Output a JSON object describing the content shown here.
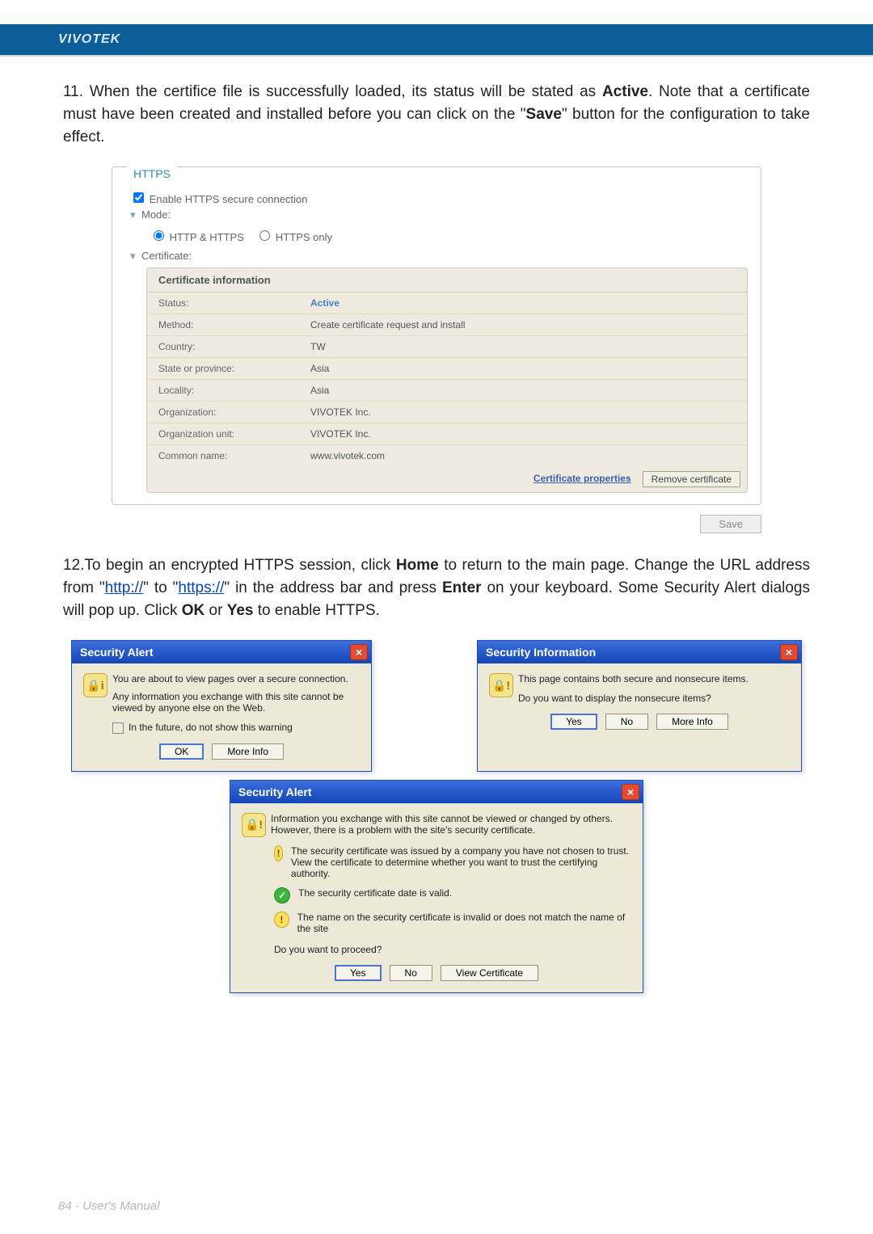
{
  "brand": "VIVOTEK",
  "step11": "11. When the certifice file is successfully loaded, its status will be stated as ",
  "step11_active": "Active",
  "step11_b": ". Note that a certificate must have been created and installed before you can click on the \"",
  "step11_save": "Save",
  "step11_c": "\" button for the configuration to take effect.",
  "https": {
    "legend": "HTTPS",
    "enable_label": "Enable HTTPS secure connection",
    "mode_label": "Mode:",
    "mode_a": "HTTP & HTTPS",
    "mode_b": "HTTPS only",
    "cert_label": "Certificate:",
    "cert_head": "Certificate information",
    "rows": [
      {
        "k": "Status:",
        "v": "Active",
        "cls": "active"
      },
      {
        "k": "Method:",
        "v": "Create certificate request and install"
      },
      {
        "k": "Country:",
        "v": "TW"
      },
      {
        "k": "State or province:",
        "v": "Asia"
      },
      {
        "k": "Locality:",
        "v": "Asia"
      },
      {
        "k": "Organization:",
        "v": "VIVOTEK Inc."
      },
      {
        "k": "Organization unit:",
        "v": "VIVOTEK Inc."
      },
      {
        "k": "Common name:",
        "v": "www.vivotek.com"
      }
    ],
    "cert_props": "Certificate properties",
    "remove": "Remove certificate",
    "save": "Save"
  },
  "step12_a": "12.To begin an encrypted HTTPS session, click ",
  "step12_home": "Home",
  "step12_b": " to return to the main page. Change the URL address from \"",
  "step12_http": "http://",
  "step12_c": "\" to \"",
  "step12_https": "https://",
  "step12_d": "\" in the address bar and press ",
  "step12_enter": "Enter",
  "step12_e": " on your keyboard. Some Security Alert dialogs will pop up. Click ",
  "step12_ok": "OK",
  "step12_or": " or ",
  "step12_yes": "Yes",
  "step12_f": " to enable HTTPS.",
  "dlg1": {
    "title": "Security Alert",
    "msg1": "You are about to view pages over a secure connection.",
    "msg2": "Any information you exchange with this site cannot be viewed by anyone else on the Web.",
    "chk": "In the future, do not show this warning",
    "ok": "OK",
    "more": "More Info"
  },
  "dlg2": {
    "title": "Security Information",
    "msg1": "This page contains both secure and nonsecure items.",
    "msg2": "Do you want to display the nonsecure items?",
    "yes": "Yes",
    "no": "No",
    "more": "More Info"
  },
  "dlg3": {
    "title": "Security Alert",
    "intro": "Information you exchange with this site cannot be viewed or changed by others. However, there is a problem with the site's security certificate.",
    "l1": "The security certificate was issued by a company you have not chosen to trust. View the certificate to determine whether you want to trust the certifying authority.",
    "l2": "The security certificate date is valid.",
    "l3": "The name on the security certificate is invalid or does not match the name of the site",
    "q": "Do you want to proceed?",
    "yes": "Yes",
    "no": "No",
    "view": "View Certificate"
  },
  "footer": "84 - User's Manual"
}
